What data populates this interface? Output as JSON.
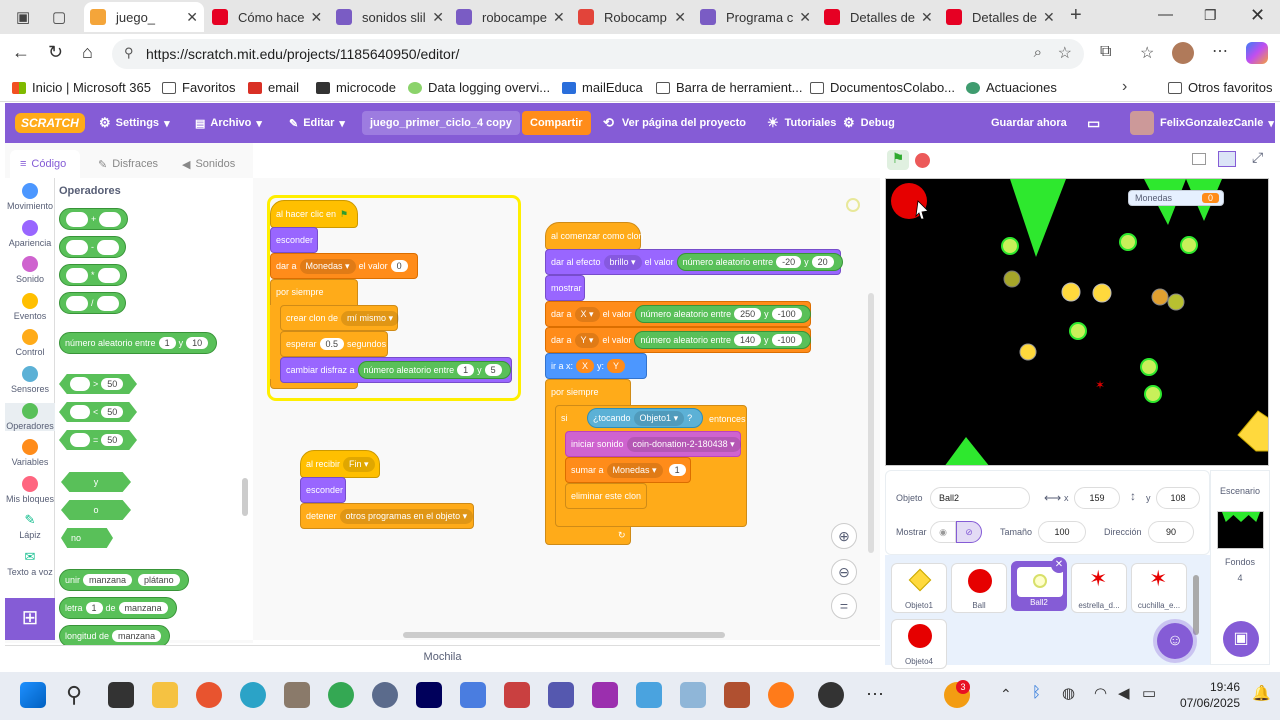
{
  "browser_tabs": [
    {
      "label": "juego_",
      "color": "#f4a53a",
      "active": true
    },
    {
      "label": "Cómo hace",
      "color": "#e60023"
    },
    {
      "label": "sonidos slil",
      "color": "#7a5cc4"
    },
    {
      "label": "robocampe",
      "color": "#7a5cc4"
    },
    {
      "label": "Robocamp",
      "color": "#e2443a"
    },
    {
      "label": "Programa c",
      "color": "#7a5cc4"
    },
    {
      "label": "Detalles de",
      "color": "#e60023"
    },
    {
      "label": "Detalles de",
      "color": "#e60023"
    }
  ],
  "url": "https://scratch.mit.edu/projects/1185640950/editor/",
  "bookmarks": [
    "Inicio | Microsoft 365",
    "Favoritos",
    "email",
    "microcode",
    "Data logging overvi...",
    "mailEduca",
    "Barra de herramient...",
    "DocumentosColabo...",
    "Actuaciones",
    "Otros favoritos"
  ],
  "menu": {
    "logo": "SCRATCH",
    "settings": "Settings",
    "archivo": "Archivo",
    "editar": "Editar",
    "project_title": "juego_primer_ciclo_4 copy",
    "compartir": "Compartir",
    "ver_pagina": "Ver página del proyecto",
    "tutoriales": "Tutoriales",
    "debug": "Debug",
    "guardar": "Guardar ahora",
    "user": "FelixGonzalezCanle"
  },
  "editor_tabs": {
    "codigo": "Código",
    "disfraces": "Disfraces",
    "sonidos": "Sonidos"
  },
  "categories": [
    {
      "label": "Movimiento",
      "color": "#4c97ff"
    },
    {
      "label": "Apariencia",
      "color": "#9966ff"
    },
    {
      "label": "Sonido",
      "color": "#cf63cf"
    },
    {
      "label": "Eventos",
      "color": "#ffbf00"
    },
    {
      "label": "Control",
      "color": "#ffab19"
    },
    {
      "label": "Sensores",
      "color": "#5cb1d6"
    },
    {
      "label": "Operadores",
      "color": "#59c059"
    },
    {
      "label": "Variables",
      "color": "#ff8c1a"
    },
    {
      "label": "Mis bloques",
      "color": "#ff6680"
    },
    {
      "label": "Lápiz",
      "color": "#0fbd8c"
    },
    {
      "label": "Texto a voz",
      "color": "#0fbd8c"
    }
  ],
  "palette": {
    "heading": "Operadores",
    "ops": [
      "+",
      "-",
      "*",
      "/"
    ],
    "random": {
      "label": "número aleatorio entre",
      "a": "1",
      "y": "y",
      "b": "10"
    },
    "compare": [
      {
        "op": ">",
        "v": "50"
      },
      {
        "op": "<",
        "v": "50"
      },
      {
        "op": "=",
        "v": "50"
      }
    ],
    "bool": [
      "y",
      "o",
      "no"
    ],
    "unir": {
      "label": "unir",
      "a": "manzana",
      "b": "plátano"
    },
    "letra": {
      "label": "letra",
      "n": "1",
      "de": "de",
      "s": "manzana"
    },
    "longitud": {
      "label": "longitud de",
      "s": "manzana"
    }
  },
  "script1": {
    "hat": "al hacer clic en",
    "esconder": "esconder",
    "dar_a": "dar a",
    "var": "Monedas",
    "el_valor": "el valor",
    "v0": "0",
    "por_siempre": "por siempre",
    "crear_clon": "crear clon de",
    "mi_mismo": "mí mismo",
    "esperar": "esperar",
    "esp_v": "0.5",
    "segundos": "segundos",
    "cambiar_disfraz": "cambiar disfraz a",
    "rand": "número aleatorio entre",
    "r1": "1",
    "y": "y",
    "r2": "5"
  },
  "script2": {
    "hat": "al comenzar como clon",
    "dar_efecto": "dar al efecto",
    "brillo": "brillo",
    "el_valor": "el valor",
    "rand": "número aleatorio entre",
    "b1": "-20",
    "y": "y",
    "b2": "20",
    "mostrar": "mostrar",
    "dar_a": "dar a",
    "x": "X",
    "y_var": "Y",
    "x1": "250",
    "x2": "-100",
    "y1": "140",
    "y2": "-100",
    "ir_a": "ir a x:",
    "ir_y": "y:",
    "por_siempre": "por siempre",
    "si": "si",
    "tocando": "¿tocando",
    "objeto1": "Objeto1",
    "q": "?",
    "entonces": "entonces",
    "iniciar_sonido": "iniciar sonido",
    "sonido": "coin-donation-2-180438",
    "sumar": "sumar a",
    "monedas": "Monedas",
    "s1": "1",
    "eliminar": "eliminar este clon"
  },
  "script3": {
    "hat": "al recibir",
    "msg": "Fin",
    "esconder": "esconder",
    "detener": "detener",
    "otros": "otros programas en el objeto"
  },
  "stage": {
    "monitor_label": "Monedas",
    "monitor_value": "0"
  },
  "sprite_info": {
    "objeto_label": "Objeto",
    "objeto": "Ball2",
    "x_label": "x",
    "x": "159",
    "y_label": "y",
    "y": "108",
    "mostrar": "Mostrar",
    "tamano_label": "Tamaño",
    "tamano": "100",
    "direccion_label": "Dirección",
    "direccion": "90"
  },
  "sprites": [
    {
      "name": "Objeto1"
    },
    {
      "name": "Ball"
    },
    {
      "name": "Ball2",
      "selected": true
    },
    {
      "name": "estrella_d..."
    },
    {
      "name": "cuchilla_e..."
    },
    {
      "name": "Objeto4"
    }
  ],
  "stage_panel": {
    "label": "Escenario",
    "fondos_label": "Fondos",
    "fondos": "4"
  },
  "mochila": "Mochila",
  "taskbar": {
    "time": "19:46",
    "date": "07/06/2025",
    "badge": "3"
  }
}
